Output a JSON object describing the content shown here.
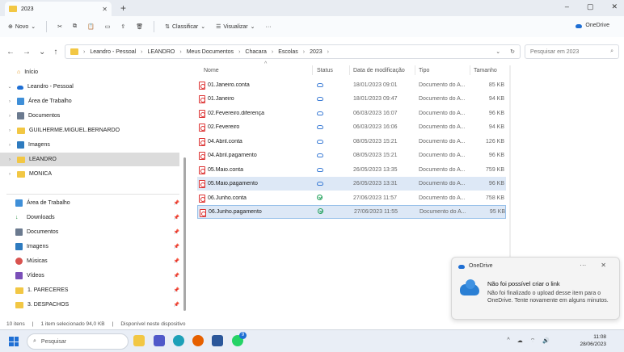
{
  "window": {
    "tab_title": "2023",
    "min": "–",
    "max": "▢",
    "close": "✕"
  },
  "toolbar": {
    "new": "Novo",
    "sort": "Classificar",
    "view": "Visualizar",
    "more": "···",
    "onedrive": "OneDrive"
  },
  "address": {
    "crumbs": [
      "Leandro - Pessoal",
      "LEANDRO",
      "Meus Documentos",
      "Chacara",
      "Escolas",
      "2023"
    ],
    "search_placeholder": "Pesquisar em 2023"
  },
  "sidebar": {
    "items": [
      {
        "label": "Início",
        "icon": "home-icon",
        "arrow": "",
        "indent": 0
      },
      {
        "label": "Leandro - Pessoal",
        "icon": "onedrive-icon",
        "arrow": "⌄",
        "indent": 0
      },
      {
        "label": "Área de Trabalho",
        "icon": "desktop-icon",
        "arrow": "›",
        "indent": 1
      },
      {
        "label": "Documentos",
        "icon": "documents-icon",
        "arrow": "›",
        "indent": 1
      },
      {
        "label": "GUILHERME.MIGUEL.BERNARDO",
        "icon": "folder-icon",
        "arrow": "›",
        "indent": 1
      },
      {
        "label": "Imagens",
        "icon": "images-icon",
        "arrow": "›",
        "indent": 1
      },
      {
        "label": "LEANDRO",
        "icon": "folder-icon",
        "arrow": "›",
        "indent": 1,
        "selected": true
      },
      {
        "label": "MONICA",
        "icon": "folder-icon",
        "arrow": "›",
        "indent": 1
      }
    ],
    "quick": [
      {
        "label": "Área de Trabalho",
        "icon": "desktop-icon"
      },
      {
        "label": "Downloads",
        "icon": "download-icon"
      },
      {
        "label": "Documentos",
        "icon": "documents-icon"
      },
      {
        "label": "Imagens",
        "icon": "images-icon"
      },
      {
        "label": "Músicas",
        "icon": "music-icon"
      },
      {
        "label": "Vídeos",
        "icon": "video-icon"
      },
      {
        "label": "1. PARECERES",
        "icon": "folder-icon"
      },
      {
        "label": "3. DESPACHOS",
        "icon": "folder-icon"
      }
    ]
  },
  "columns": {
    "name": "Nome",
    "status": "Status",
    "date": "Data de modificação",
    "type": "Tipo",
    "size": "Tamanho"
  },
  "files": [
    {
      "name": "01.Janeiro.conta",
      "status": "cloud",
      "date": "18/01/2023 09:01",
      "type": "Documento do A...",
      "size": "85 KB"
    },
    {
      "name": "01.Janeiro",
      "status": "cloud",
      "date": "18/01/2023 09:47",
      "type": "Documento do A...",
      "size": "94 KB"
    },
    {
      "name": "02.Fevereiro.diferença",
      "status": "cloud",
      "date": "06/03/2023 16:07",
      "type": "Documento do A...",
      "size": "96 KB"
    },
    {
      "name": "02.Fevereiro",
      "status": "cloud",
      "date": "06/03/2023 16:06",
      "type": "Documento do A...",
      "size": "94 KB"
    },
    {
      "name": "04.Abril.conta",
      "status": "cloud",
      "date": "08/05/2023 15:21",
      "type": "Documento do A...",
      "size": "126 KB"
    },
    {
      "name": "04.Abril.pagamento",
      "status": "cloud",
      "date": "08/05/2023 15:21",
      "type": "Documento do A...",
      "size": "96 KB"
    },
    {
      "name": "05.Maio.conta",
      "status": "cloud",
      "date": "26/05/2023 13:35",
      "type": "Documento do A...",
      "size": "759 KB"
    },
    {
      "name": "05.Maio.pagamento",
      "status": "cloud",
      "date": "26/05/2023 13:31",
      "type": "Documento do A...",
      "size": "96 KB",
      "selected": true
    },
    {
      "name": "06.Junho.conta",
      "status": "synced",
      "date": "27/06/2023 11:57",
      "type": "Documento do A...",
      "size": "758 KB"
    },
    {
      "name": "06.Junho.pagamento",
      "status": "synced",
      "date": "27/06/2023 11:55",
      "type": "Documento do A...",
      "size": "95 KB",
      "selected": true,
      "focused": true
    }
  ],
  "statusbar": {
    "count": "10 itens",
    "selected": "1 item selecionado 94,0 KB",
    "availability": "Disponível neste dispositivo"
  },
  "toast": {
    "app": "OneDrive",
    "more": "···",
    "close": "✕",
    "title": "Não foi possível criar o link",
    "message": "Não foi finalizado o upload desse item para o OneDrive. Tente novamente em alguns minutos."
  },
  "taskbar": {
    "search": "Pesquisar",
    "time": "11:08",
    "date": "28/06/2023",
    "badge": "9"
  },
  "colors": {
    "accent": "#1f6fd4",
    "selection": "#dde8f6",
    "folder": "#f2c744",
    "pdf": "#d33333"
  }
}
